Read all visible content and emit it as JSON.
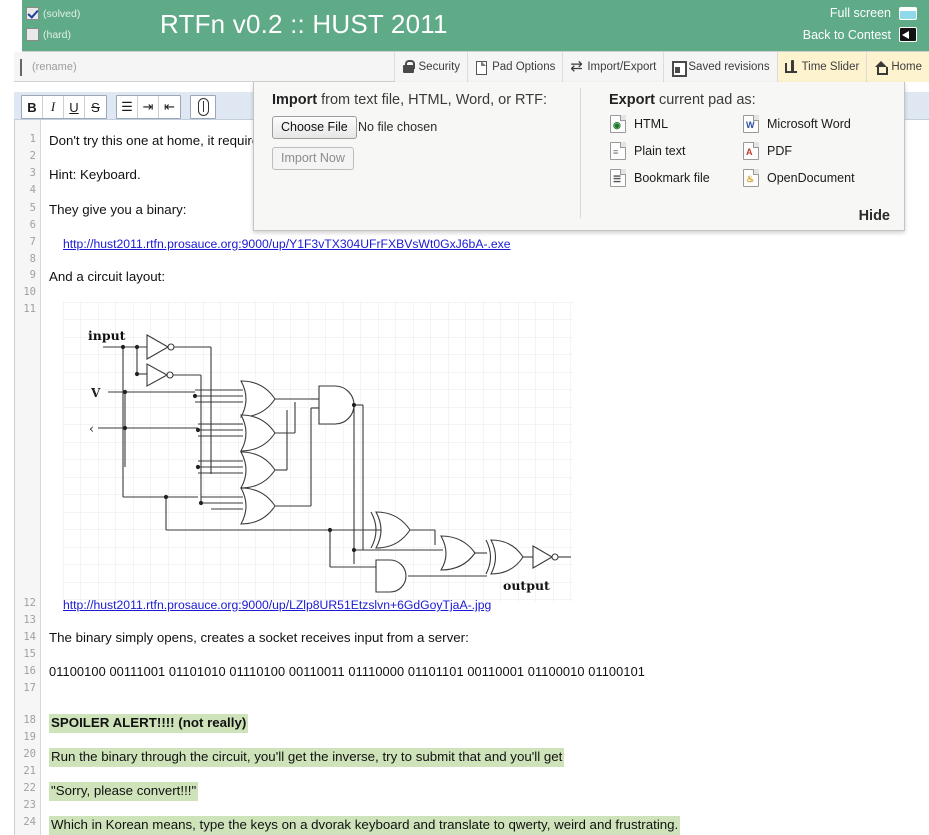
{
  "header": {
    "title": "RTFn v0.2 :: HUST 2011",
    "solved_label": "(solved)",
    "hard_label": "(hard)",
    "solved_checked": true,
    "hard_checked": false,
    "fullscreen_label": "Full screen",
    "back_label": "Back to Contest",
    "bg_color": "#5faa87"
  },
  "menubar": {
    "rename_label": "(rename)",
    "tabs": [
      {
        "label": "Security",
        "icon": "lock-icon",
        "active": false
      },
      {
        "label": "Pad Options",
        "icon": "document-icon",
        "active": false
      },
      {
        "label": "Import/Export",
        "icon": "swap-icon",
        "active": false
      },
      {
        "label": "Saved revisions",
        "icon": "save-icon",
        "active": false
      },
      {
        "label": "Time Slider",
        "icon": "slider-icon",
        "active": true
      },
      {
        "label": "Home",
        "icon": "home-icon",
        "active": true
      }
    ],
    "active_bg": "#fdf3cf"
  },
  "editor_toolbar": {
    "buttons": [
      {
        "name": "bold-button",
        "label": "B"
      },
      {
        "name": "italic-button",
        "label": "I"
      },
      {
        "name": "underline-button",
        "label": "U"
      },
      {
        "name": "strikethrough-button",
        "label": "S"
      },
      {
        "name": "list-button",
        "label": "☰"
      },
      {
        "name": "indent-button",
        "label": "⇥"
      },
      {
        "name": "outdent-button",
        "label": "⇤"
      },
      {
        "name": "attachment-button",
        "label": "ὌE"
      }
    ]
  },
  "import_export": {
    "import_heading_bold": "Import",
    "import_heading_rest": " from text file, HTML, Word, or RTF:",
    "choose_file_label": "Choose File",
    "no_file_label": "No file chosen",
    "import_now_label": "Import Now",
    "export_heading_bold": "Export",
    "export_heading_rest": " current pad as:",
    "export_options": [
      {
        "label": "HTML",
        "icon": "html-file-icon",
        "mark": "◉",
        "cls": "globe"
      },
      {
        "label": "Microsoft Word",
        "icon": "word-file-icon",
        "mark": "W",
        "cls": "word"
      },
      {
        "label": "Plain text",
        "icon": "text-file-icon",
        "mark": "≡",
        "cls": "txt"
      },
      {
        "label": "PDF",
        "icon": "pdf-file-icon",
        "mark": "A",
        "cls": "pdf"
      },
      {
        "label": "Bookmark file",
        "icon": "bookmark-file-icon",
        "mark": "☰",
        "cls": "bm"
      },
      {
        "label": "OpenDocument",
        "icon": "odt-file-icon",
        "mark": "♨",
        "cls": "odt"
      }
    ],
    "hide_label": "Hide"
  },
  "document": {
    "line_numbers": [
      1,
      2,
      3,
      4,
      5,
      6,
      7,
      8,
      9,
      10,
      11,
      12,
      13,
      14,
      15,
      16,
      17,
      18,
      19,
      20,
      21,
      22,
      23,
      24
    ],
    "lines": {
      "l1": "Don't try this one at home, it require",
      "l3": "Hint: Keyboard.",
      "l5": "They give you a binary:",
      "l7": "http://hust2011.rtfn.prosauce.org:9000/up/Y1F3vTX304UFrFXBVsWt0GxJ6bA-.exe",
      "l9": "And a circuit layout:",
      "l11_img_link": "http://hust2011.rtfn.prosauce.org:9000/up/LZlp8UR51Etzslvn+6GdGoyTjaA-.jpg",
      "l13": "The binary simply opens, creates a socket receives input from a server:",
      "l15": "01100100 00111001 01101010 01110100 00110011 01110000 01101101 00110001 01100010 01100101",
      "l18": "SPOILER ALERT!!!! (not really)",
      "l20": "Run the binary through the circuit, you'll get the inverse, try to submit that and you'll get",
      "l22": "\"Sorry, please convert!!!\"",
      "l24": "Which in Korean means, type the keys on a dvorak keyboard and translate to qwerty, weird and frustrating."
    },
    "highlight_color": "#cfe3bb",
    "link_color": "#1a1ad6"
  },
  "circuit": {
    "input_label": "input",
    "v_label": "V",
    "caret_label": "‹",
    "output_label": "output"
  }
}
